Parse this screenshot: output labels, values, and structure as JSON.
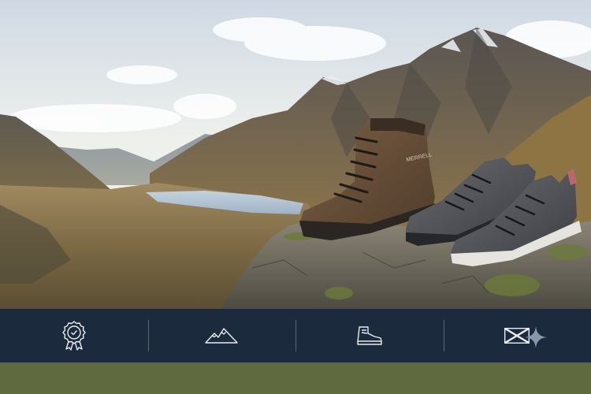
{
  "colors": {
    "feature_bar_bg": "#1c2a3e",
    "footer_strip_bg": "#5f6b3f",
    "icon_stroke": "#e9edf2",
    "sparkle": "#8a97ab"
  },
  "hero": {
    "boot_brand": "MERRELL"
  },
  "features": [
    {
      "icon": "award-badge-icon"
    },
    {
      "icon": "mountain-icon"
    },
    {
      "icon": "hiking-boot-icon"
    },
    {
      "icon": "scotland-flag-icon"
    }
  ]
}
